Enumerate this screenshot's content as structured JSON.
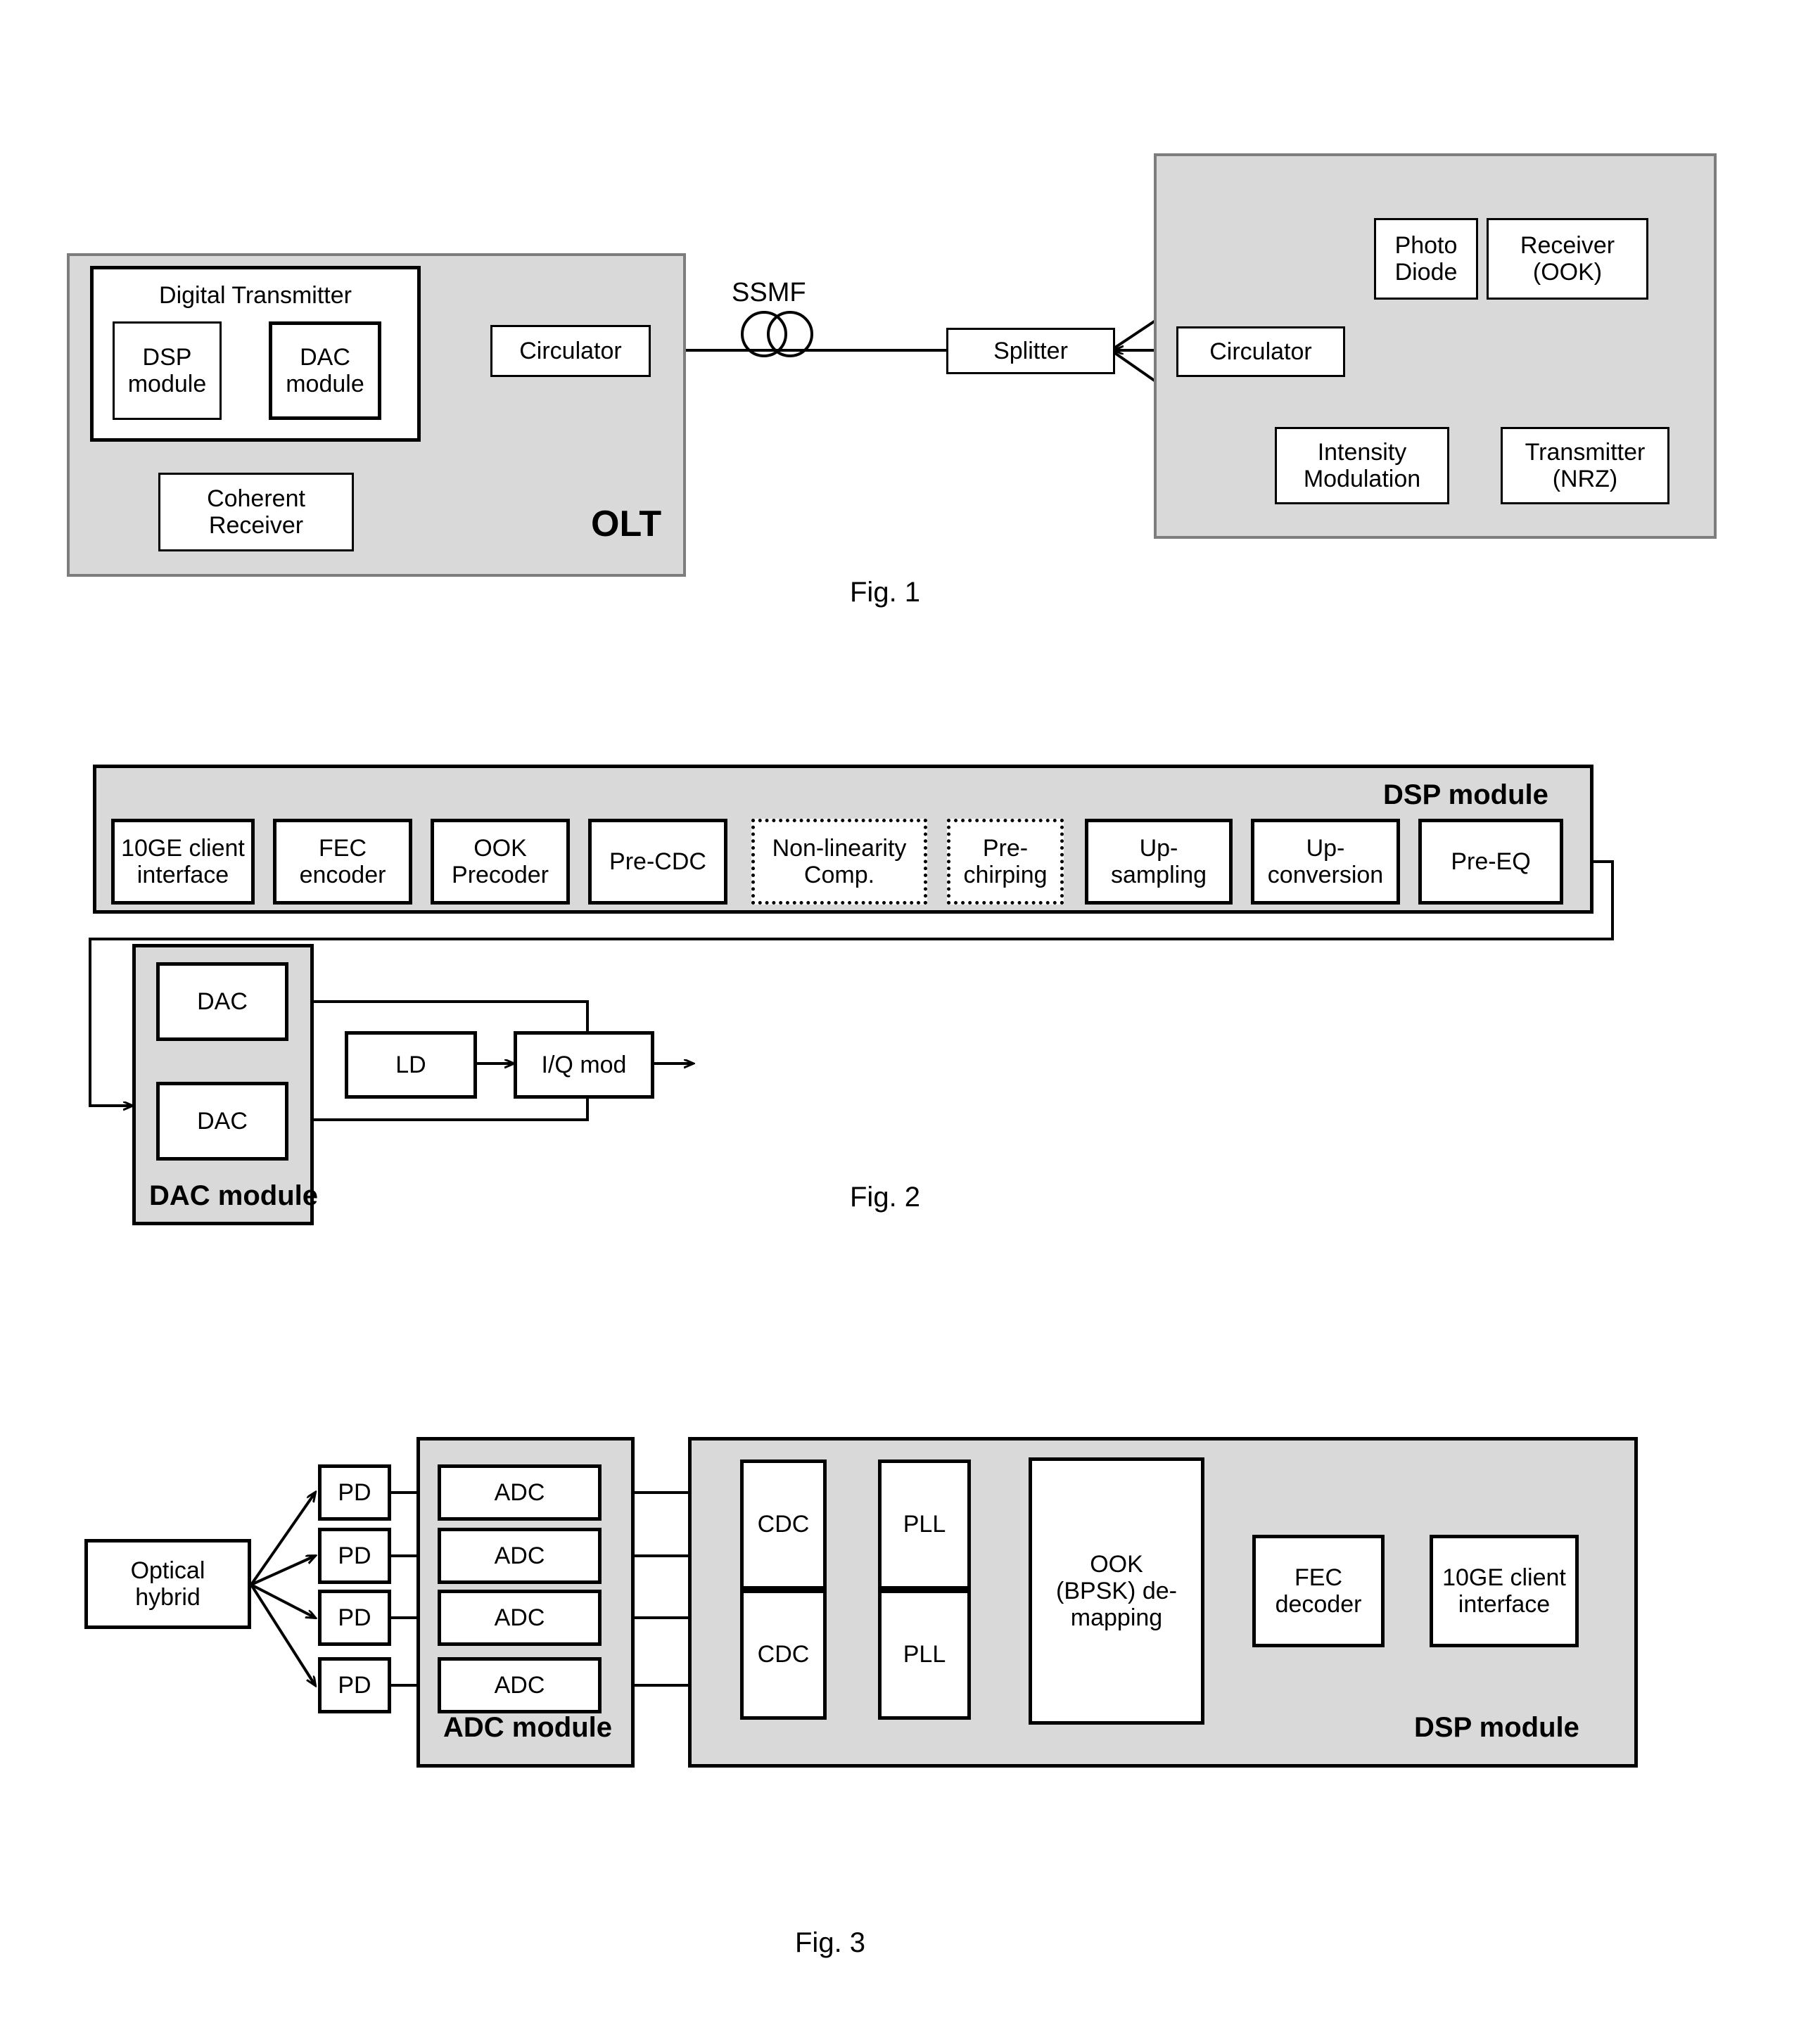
{
  "figures": [
    {
      "caption": "Fig. 1",
      "olt": {
        "label": "OLT",
        "digital_transmitter": {
          "title": "Digital Transmitter",
          "blocks": [
            {
              "line1": "DSP",
              "line2": "module"
            },
            {
              "line1": "DAC",
              "line2": "module"
            }
          ]
        },
        "circulator": "Circulator",
        "coherent_receiver": {
          "line1": "Coherent",
          "line2": "Receiver"
        }
      },
      "link": {
        "fiber_label": "SSMF",
        "splitter": "Splitter"
      },
      "onu": {
        "circulator": "Circulator",
        "photo_diode": {
          "line1": "Photo",
          "line2": "Diode"
        },
        "receiver": {
          "line1": "Receiver",
          "line2": "(OOK)"
        },
        "intensity_modulation": {
          "line1": "Intensity",
          "line2": "Modulation"
        },
        "transmitter": {
          "line1": "Transmitter",
          "line2": "(NRZ)"
        }
      }
    },
    {
      "caption": "Fig. 2",
      "dsp_module_label": "DSP module",
      "dac_module_label": "DAC module",
      "chain": [
        {
          "line1": "10GE client",
          "line2": "interface",
          "style": "solid"
        },
        {
          "line1": "FEC",
          "line2": "encoder",
          "style": "solid"
        },
        {
          "line1": "OOK",
          "line2": "Precoder",
          "style": "solid"
        },
        {
          "line1": "Pre-CDC",
          "line2": "",
          "style": "solid"
        },
        {
          "line1": "Non-linearity",
          "line2": "Comp.",
          "style": "dotted"
        },
        {
          "line1": "Pre-",
          "line2": "chirping",
          "style": "dotted"
        },
        {
          "line1": "Up-",
          "line2": "sampling",
          "style": "solid"
        },
        {
          "line1": "Up-",
          "line2": "conversion",
          "style": "solid"
        },
        {
          "line1": "Pre-EQ",
          "line2": "",
          "style": "solid"
        }
      ],
      "analog": {
        "dac_top": "DAC",
        "dac_bottom": "DAC",
        "ld": "LD",
        "iq_mod": "I/Q mod"
      }
    },
    {
      "caption": "Fig. 3",
      "adc_module_label": "ADC module",
      "dsp_module_label": "DSP module",
      "optical_hybrid": {
        "line1": "Optical",
        "line2": "hybrid"
      },
      "pds": [
        "PD",
        "PD",
        "PD",
        "PD"
      ],
      "adcs": [
        "ADC",
        "ADC",
        "ADC",
        "ADC"
      ],
      "cdcs": [
        "CDC",
        "CDC"
      ],
      "plls": [
        "PLL",
        "PLL"
      ],
      "demapping": {
        "line1": "OOK",
        "line2": "(BPSK) de-",
        "line3": "mapping"
      },
      "fec_decoder": {
        "line1": "FEC",
        "line2": "decoder"
      },
      "client_interface": {
        "line1": "10GE client",
        "line2": "interface"
      }
    }
  ],
  "colors": {
    "shade_fill": "#d9d9d9",
    "shade_border": "#7d7d7d",
    "ink": "#000000",
    "paper": "#ffffff"
  }
}
